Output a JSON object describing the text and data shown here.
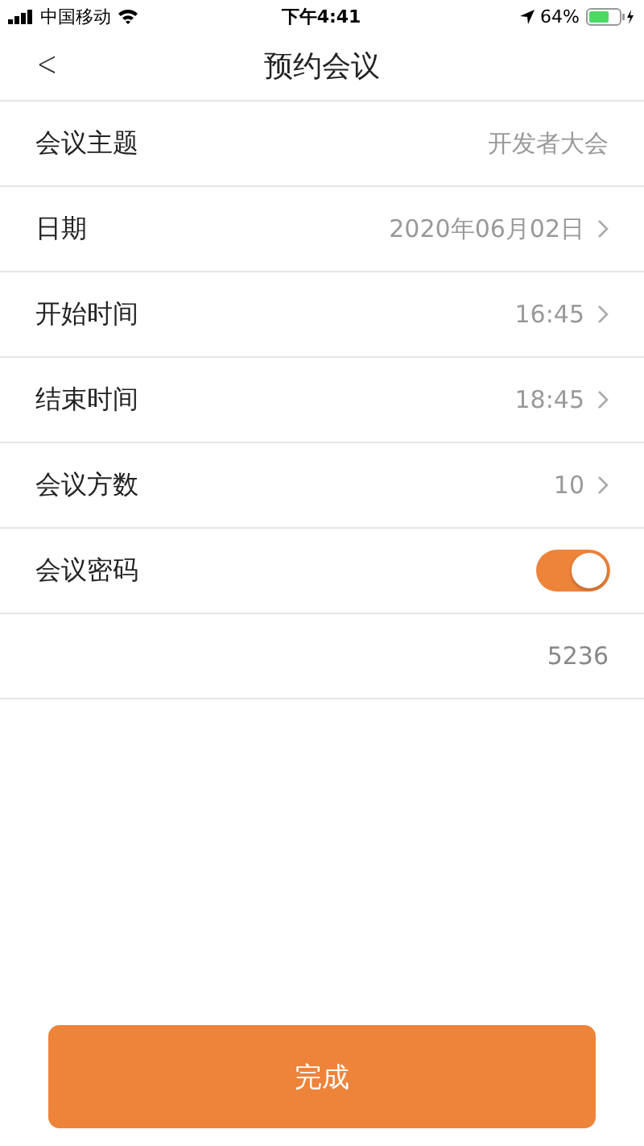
{
  "status_bar": {
    "carrier": "中国移动",
    "time": "下午4:41",
    "battery": "64%"
  },
  "nav": {
    "back": "<",
    "title": "预约会议"
  },
  "rows": [
    {
      "kind": "text",
      "label": "会议主题",
      "value": "开发者大会"
    },
    {
      "kind": "picker",
      "label": "日期",
      "value": "2020年06月02日"
    },
    {
      "kind": "picker",
      "label": "开始时间",
      "value": "16:45"
    },
    {
      "kind": "picker",
      "label": "结束时间",
      "value": "18:45"
    },
    {
      "kind": "picker",
      "label": "会议方数",
      "value": "10"
    },
    {
      "kind": "toggle",
      "label": "会议密码",
      "on": true
    },
    {
      "kind": "value",
      "value": "5236"
    }
  ],
  "button": "完成"
}
